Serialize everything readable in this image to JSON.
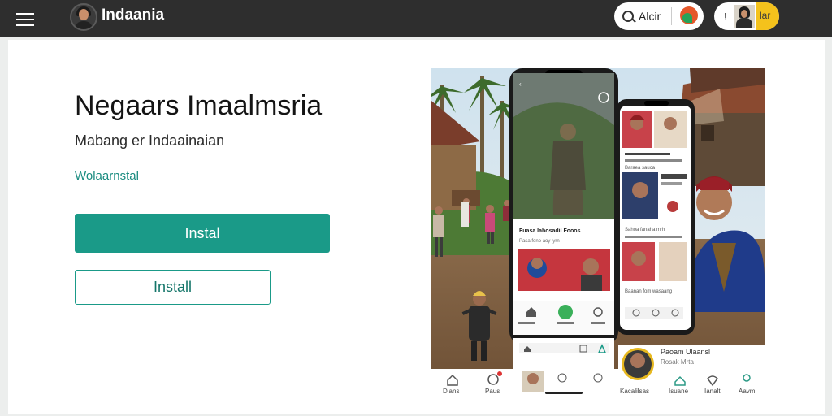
{
  "header": {
    "brand_name": "Indaania",
    "search_label": "Alcir",
    "user_indicator": "!",
    "user_badge": "lar"
  },
  "main": {
    "title": "Negaars Imaalmsria",
    "subtitle": "Mabang er Indaainaian",
    "link": "Wolaarnstal",
    "primary_button": "Instal",
    "secondary_button": "Install"
  },
  "hero": {
    "phone1_headline": "Fuasa Iahosadil Fooos",
    "phone1_subline": "Pasa feno aoy iyrn",
    "phone2_caption_a": "Baraea sauca",
    "phone2_caption_b": "Sahoa fanaha mrh",
    "phone2_caption_c": "Baanan fom wasaang",
    "phone3_name": "Paoam Ulaansl",
    "phone3_meta": "Rosak Mrta",
    "tabs_left": [
      "Dlans",
      "Paus"
    ],
    "tabs_right": [
      "Kacalilsas",
      "Isuane",
      "Ianalt",
      "Aavm"
    ]
  },
  "colors": {
    "accent": "#1a9a88",
    "topbar": "#2e2e2e",
    "badge_yellow": "#f4c21c"
  }
}
